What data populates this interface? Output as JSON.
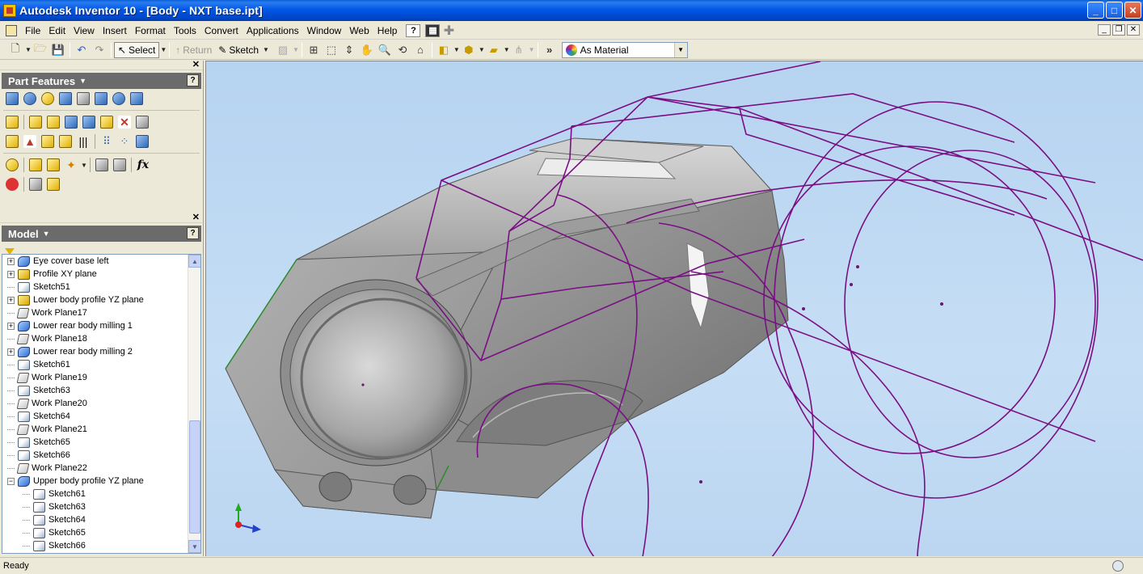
{
  "window": {
    "title": "Autodesk Inventor 10 - [Body - NXT base.ipt]",
    "buttons": {
      "minimize": "_",
      "maximize": "□",
      "close": "✕"
    }
  },
  "menu": {
    "items": [
      "File",
      "Edit",
      "View",
      "Insert",
      "Format",
      "Tools",
      "Convert",
      "Applications",
      "Window",
      "Web",
      "Help"
    ],
    "mdi": {
      "minimize": "_",
      "restore": "❐",
      "close": "✕"
    }
  },
  "toolbar": {
    "select_label": "Select",
    "return_label": "Return",
    "sketch_label": "Sketch",
    "material_value": "As Material"
  },
  "part_features": {
    "title": "Part Features",
    "close": "✕",
    "help": "?",
    "fx": "fx"
  },
  "model": {
    "title": "Model",
    "close": "✕",
    "help": "?",
    "tree": [
      {
        "label": "Eye cover base left",
        "type": "sweep",
        "expander": "+",
        "level": 0
      },
      {
        "label": "Profile XY plane",
        "type": "extrude",
        "expander": "+",
        "level": 0
      },
      {
        "label": "Sketch51",
        "type": "sketch",
        "expander": "",
        "level": 0
      },
      {
        "label": "Lower body profile YZ plane",
        "type": "extrude",
        "expander": "+",
        "level": 0
      },
      {
        "label": "Work Plane17",
        "type": "plane",
        "expander": "",
        "level": 0
      },
      {
        "label": "Lower rear body milling 1",
        "type": "sweep",
        "expander": "+",
        "level": 0
      },
      {
        "label": "Work Plane18",
        "type": "plane",
        "expander": "",
        "level": 0
      },
      {
        "label": "Lower rear body milling 2",
        "type": "sweep",
        "expander": "+",
        "level": 0
      },
      {
        "label": "Sketch61",
        "type": "sketch",
        "expander": "",
        "level": 0
      },
      {
        "label": "Work Plane19",
        "type": "plane",
        "expander": "",
        "level": 0
      },
      {
        "label": "Sketch63",
        "type": "sketch",
        "expander": "",
        "level": 0
      },
      {
        "label": "Work Plane20",
        "type": "plane",
        "expander": "",
        "level": 0
      },
      {
        "label": "Sketch64",
        "type": "sketch",
        "expander": "",
        "level": 0
      },
      {
        "label": "Work Plane21",
        "type": "plane",
        "expander": "",
        "level": 0
      },
      {
        "label": "Sketch65",
        "type": "sketch",
        "expander": "",
        "level": 0
      },
      {
        "label": "Sketch66",
        "type": "sketch",
        "expander": "",
        "level": 0
      },
      {
        "label": "Work Plane22",
        "type": "plane",
        "expander": "",
        "level": 0
      },
      {
        "label": "Upper body profile YZ plane",
        "type": "sweep",
        "expander": "−",
        "level": 0
      },
      {
        "label": "Sketch61",
        "type": "sketch",
        "expander": "",
        "level": 1
      },
      {
        "label": "Sketch63",
        "type": "sketch",
        "expander": "",
        "level": 1
      },
      {
        "label": "Sketch64",
        "type": "sketch",
        "expander": "",
        "level": 1
      },
      {
        "label": "Sketch65",
        "type": "sketch",
        "expander": "",
        "level": 1
      },
      {
        "label": "Sketch66",
        "type": "sketch",
        "expander": "",
        "level": 1
      }
    ]
  },
  "status": {
    "text": "Ready"
  },
  "colors": {
    "sketch_lines": "#7a0f84",
    "viewport_bg": "#c0daf3",
    "titlebar": "#0058e6"
  }
}
